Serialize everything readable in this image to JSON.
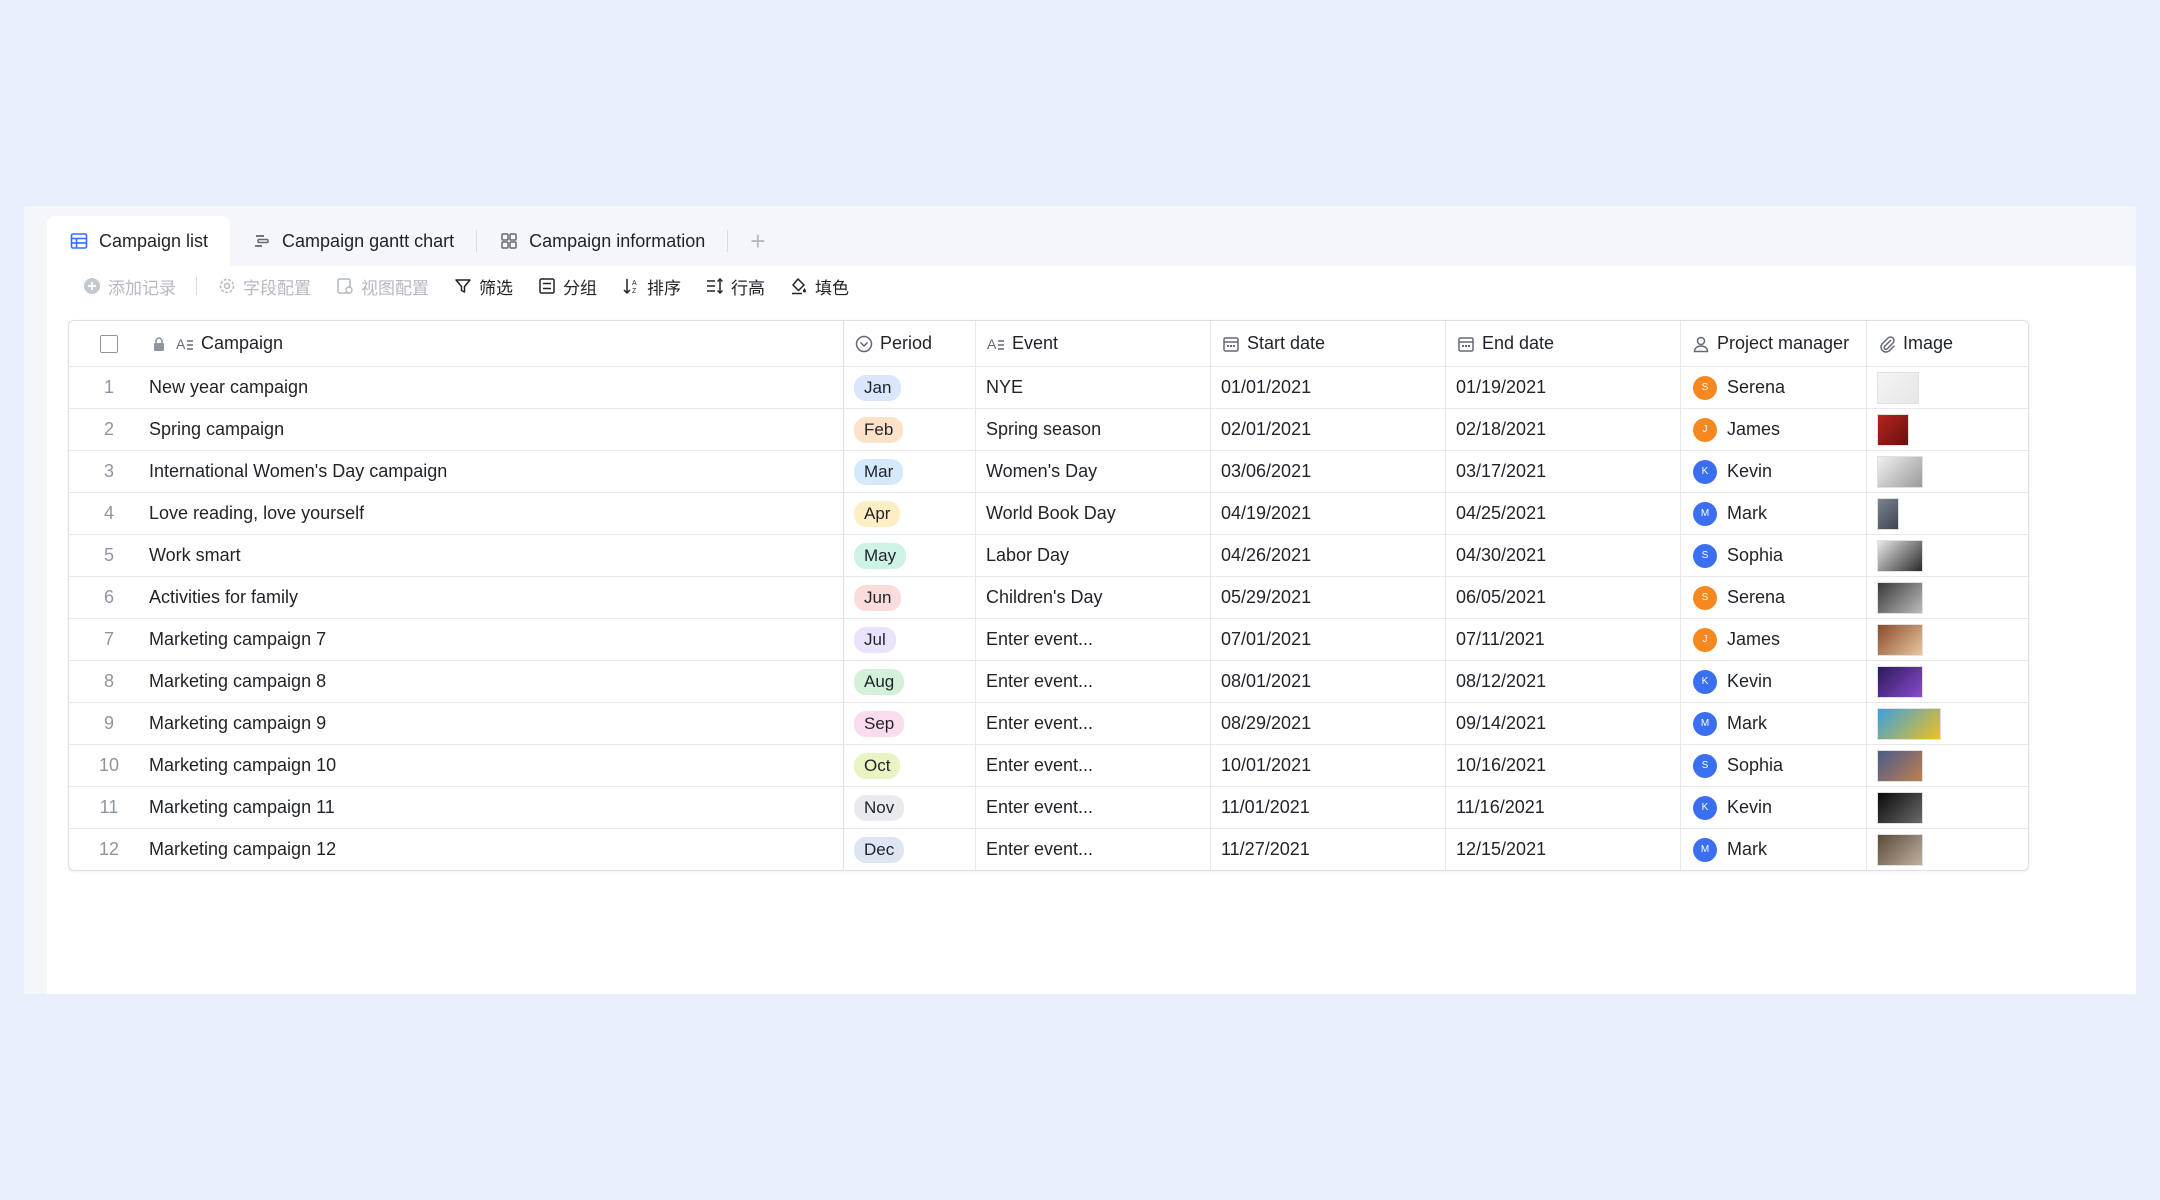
{
  "tabs": [
    {
      "label": "Campaign list",
      "icon": "grid-table-icon",
      "active": true
    },
    {
      "label": "Campaign gantt chart",
      "icon": "gantt-icon",
      "active": false
    },
    {
      "label": "Campaign information",
      "icon": "gallery-icon",
      "active": false
    }
  ],
  "add_tab_label": "+",
  "toolbar": {
    "add_record": "添加记录",
    "field_config": "字段配置",
    "view_config": "视图配置",
    "filter": "筛选",
    "group": "分组",
    "sort": "排序",
    "row_height": "行高",
    "fill_color": "填色"
  },
  "columns": {
    "campaign": "Campaign",
    "period": "Period",
    "event": "Event",
    "start_date": "Start date",
    "end_date": "End date",
    "project_manager": "Project manager",
    "image": "Image"
  },
  "colors": {
    "accent": "#3370ff",
    "orange_avatar": "#f5891f",
    "blue_avatar": "#3a6ff1"
  },
  "rows": [
    {
      "num": "1",
      "campaign": "New year campaign",
      "period": "Jan",
      "period_color": "#d9e6fb",
      "event": "NYE",
      "start": "01/01/2021",
      "end": "01/19/2021",
      "pm": "Serena",
      "pm_initial": "S",
      "pm_color": "#f5891f",
      "img_colors": [
        "#f5f5f5",
        "#e6e6e6"
      ]
    },
    {
      "num": "2",
      "campaign": "Spring campaign",
      "period": "Feb",
      "period_color": "#fde2c7",
      "event": "Spring season",
      "start": "02/01/2021",
      "end": "02/18/2021",
      "pm": "James",
      "pm_initial": "J",
      "pm_color": "#f5891f",
      "img_colors": [
        "#b3241c",
        "#6b1010"
      ]
    },
    {
      "num": "3",
      "campaign": "International Women's Day campaign",
      "period": "Mar",
      "period_color": "#d4eafa",
      "event": "Women's Day",
      "start": "03/06/2021",
      "end": "03/17/2021",
      "pm": "Kevin",
      "pm_initial": "K",
      "pm_color": "#3a6ff1",
      "img_colors": [
        "#f0f0f0",
        "#9a9a9a"
      ]
    },
    {
      "num": "4",
      "campaign": "Love reading, love yourself",
      "period": "Apr",
      "period_color": "#fdeec3",
      "event": "World Book Day",
      "start": "04/19/2021",
      "end": "04/25/2021",
      "pm": "Mark",
      "pm_initial": "M",
      "pm_color": "#3a6ff1",
      "img_colors": [
        "#7a8590",
        "#3c4450"
      ]
    },
    {
      "num": "5",
      "campaign": "Work smart",
      "period": "May",
      "period_color": "#cdf2e8",
      "event": "Labor Day",
      "start": "04/26/2021",
      "end": "04/30/2021",
      "pm": "Sophia",
      "pm_initial": "S",
      "pm_color": "#3a6ff1",
      "img_colors": [
        "#e8e8e8",
        "#2a2a2a"
      ]
    },
    {
      "num": "6",
      "campaign": "Activities for family",
      "period": "Jun",
      "period_color": "#fbdcdc",
      "event": "Children's Day",
      "start": "05/29/2021",
      "end": "06/05/2021",
      "pm": "Serena",
      "pm_initial": "S",
      "pm_color": "#f5891f",
      "img_colors": [
        "#3a3a3a",
        "#bcbcbc"
      ]
    },
    {
      "num": "7",
      "campaign": "Marketing campaign 7",
      "period": "Jul",
      "period_color": "#ebe3fb",
      "event": "Enter event...",
      "start": "07/01/2021",
      "end": "07/11/2021",
      "pm": "James",
      "pm_initial": "J",
      "pm_color": "#f5891f",
      "img_colors": [
        "#8a4a2a",
        "#e8c8a0"
      ]
    },
    {
      "num": "8",
      "campaign": "Marketing campaign 8",
      "period": "Aug",
      "period_color": "#d3f0d9",
      "event": "Enter event...",
      "start": "08/01/2021",
      "end": "08/12/2021",
      "pm": "Kevin",
      "pm_initial": "K",
      "pm_color": "#3a6ff1",
      "img_colors": [
        "#2a1a5a",
        "#8a4ad0"
      ]
    },
    {
      "num": "9",
      "campaign": "Marketing campaign 9",
      "period": "Sep",
      "period_color": "#fbdcef",
      "event": "Enter event...",
      "start": "08/29/2021",
      "end": "09/14/2021",
      "pm": "Mark",
      "pm_initial": "M",
      "pm_color": "#3a6ff1",
      "img_colors": [
        "#3aa0e0",
        "#f0c020"
      ]
    },
    {
      "num": "10",
      "campaign": "Marketing campaign 10",
      "period": "Oct",
      "period_color": "#e8f5c2",
      "event": "Enter event...",
      "start": "10/01/2021",
      "end": "10/16/2021",
      "pm": "Sophia",
      "pm_initial": "S",
      "pm_color": "#3a6ff1",
      "img_colors": [
        "#4a5a8a",
        "#c08050"
      ]
    },
    {
      "num": "11",
      "campaign": "Marketing campaign 11",
      "period": "Nov",
      "period_color": "#e8eaed",
      "event": "Enter event...",
      "start": "11/01/2021",
      "end": "11/16/2021",
      "pm": "Kevin",
      "pm_initial": "K",
      "pm_color": "#3a6ff1",
      "img_colors": [
        "#0a0a0a",
        "#6a6a6a"
      ]
    },
    {
      "num": "12",
      "campaign": "Marketing campaign 12",
      "period": "Dec",
      "period_color": "#dde4f2",
      "event": "Enter event...",
      "start": "11/27/2021",
      "end": "12/15/2021",
      "pm": "Mark",
      "pm_initial": "M",
      "pm_color": "#3a6ff1",
      "img_colors": [
        "#5a4a3a",
        "#c0b0a0"
      ]
    }
  ]
}
